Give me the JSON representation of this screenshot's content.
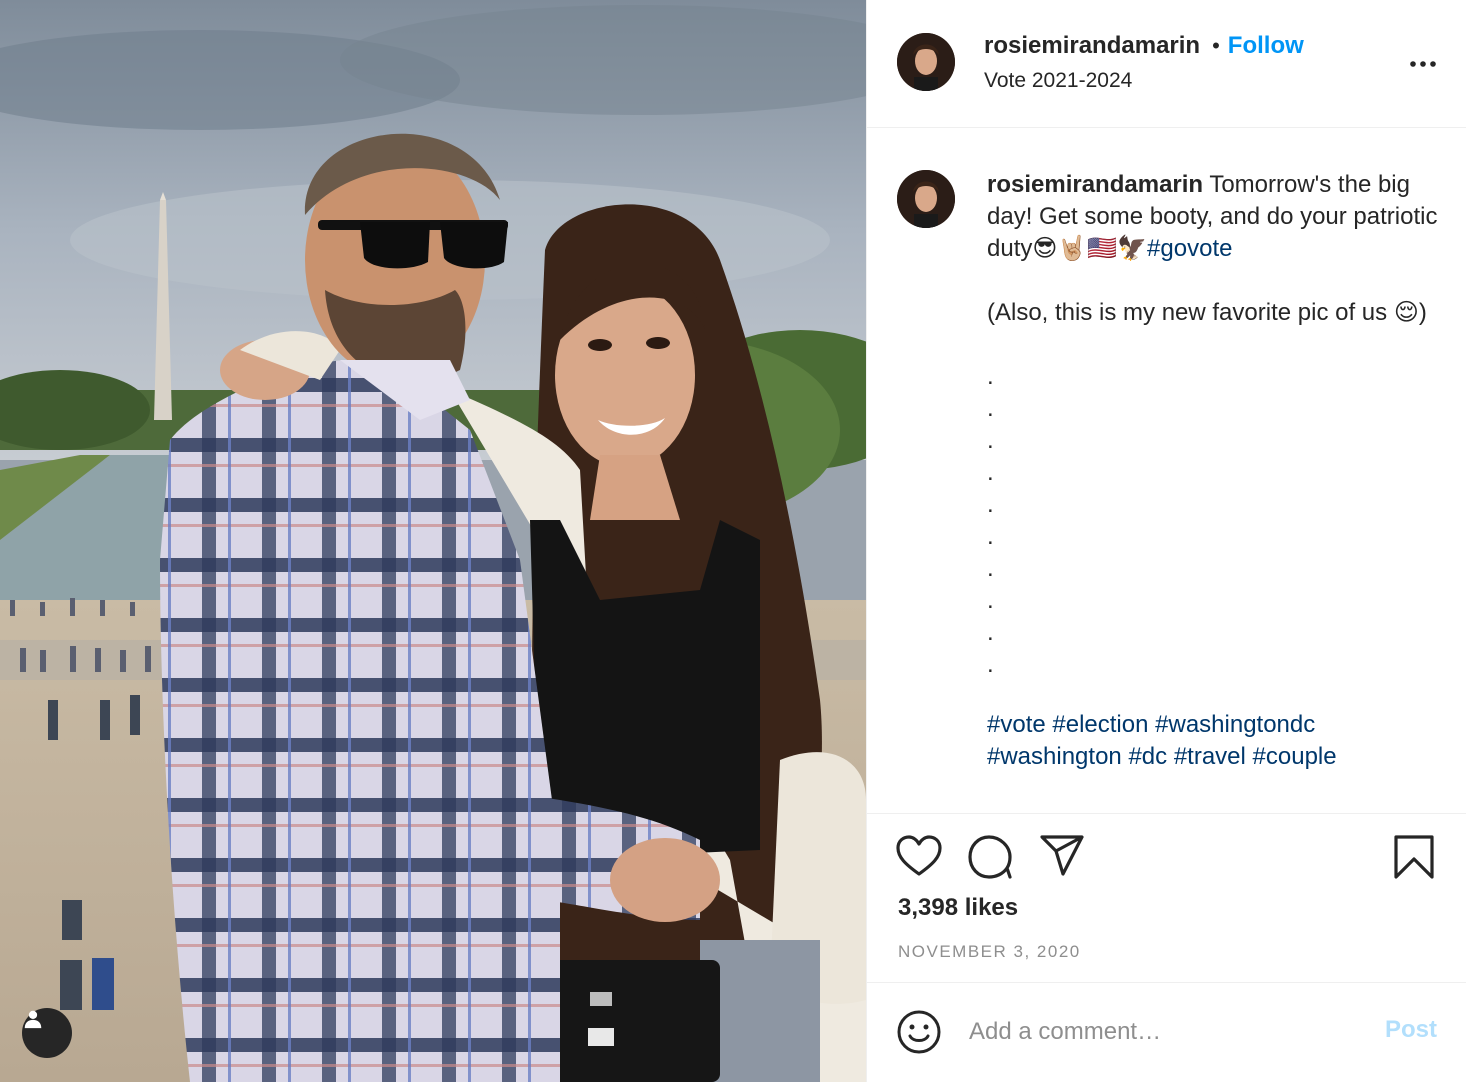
{
  "post": {
    "photo_alt": "",
    "tag_icon": "user-tag-icon"
  },
  "header": {
    "username": "rosiemirandamarin",
    "separator": "•",
    "follow_label": "Follow",
    "location": "Vote 2021-2024",
    "more_icon": "more-options-icon"
  },
  "caption": {
    "username": "rosiemirandamarin",
    "text_1": " Tomorrow's the big day! Get some booty, and do your patriotic duty",
    "emojis_1": "😎🤘🏼🇺🇸🦅",
    "hashtag_1": "#govote",
    "text_2": "(Also, this is my new favorite pic of us ",
    "emoji_2": "😌",
    "text_2_end": ")",
    "dots": [
      ".",
      ".",
      ".",
      ".",
      ".",
      ".",
      ".",
      ".",
      ".",
      "."
    ],
    "hashtags": [
      "#vote",
      "#election",
      "#washingtondc",
      "#washington",
      "#dc",
      "#travel",
      "#couple"
    ]
  },
  "actions": {
    "like_icon": "heart-icon",
    "comment_icon": "comment-bubble-icon",
    "share_icon": "paper-plane-icon",
    "save_icon": "bookmark-icon",
    "likes": "3,398 likes",
    "date": "NOVEMBER 3, 2020"
  },
  "comment": {
    "emoji_icon": "smiley-icon",
    "placeholder": "Add a comment…",
    "post_label": "Post"
  },
  "colors": {
    "link_blue": "#0095f6",
    "hashtag_blue": "#00376b",
    "post_disabled": "#b2dffc",
    "muted": "#8e8e8e"
  }
}
